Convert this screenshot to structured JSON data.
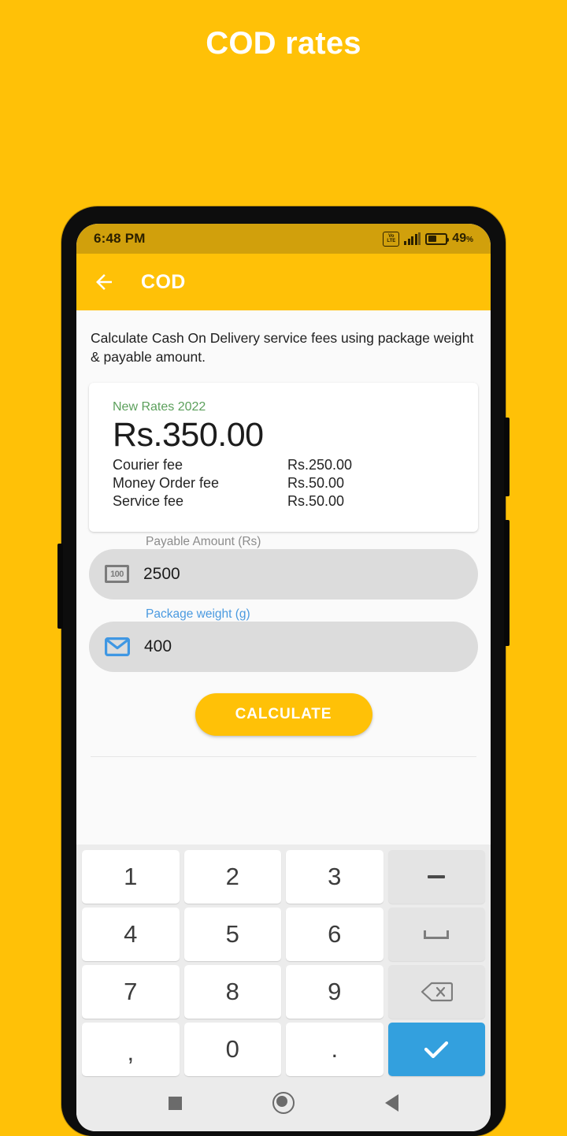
{
  "banner": {
    "title": "COD rates",
    "background_color": "#FFC107"
  },
  "status_bar": {
    "time": "6:48 PM",
    "network_badge": "VoLTE",
    "volte_top": "Vo",
    "volte_bottom": "LTE",
    "battery_percent": "49",
    "percent_sign": "%"
  },
  "app_bar": {
    "title": "COD",
    "back_icon": "back-arrow-icon",
    "background_color": "#FFC107"
  },
  "content": {
    "intro_text": "Calculate Cash On Delivery service fees using package weight & payable amount.",
    "rate_card": {
      "rates_label": "New Rates 2022",
      "rates_label_color": "#5CA05C",
      "total_amount": "Rs.350.00",
      "fees": [
        {
          "name": "Courier fee",
          "value": "Rs.250.00"
        },
        {
          "name": "Money Order fee",
          "value": "Rs.50.00"
        },
        {
          "name": "Service fee",
          "value": "Rs.50.00"
        }
      ]
    },
    "fields": [
      {
        "label": "Payable Amount (Rs)",
        "value": "2500",
        "icon": "banknote-icon",
        "icon_text": "100",
        "state": "unfocused",
        "label_color": "#8c8c8c"
      },
      {
        "label": "Package weight (g)",
        "value": "400",
        "icon": "envelope-icon",
        "state": "focused",
        "label_color": "#4a9ae0"
      }
    ],
    "calculate_button": "CALCULATE"
  },
  "keyboard": {
    "rows": [
      [
        {
          "label": "1",
          "name": "key-1",
          "type": "digit"
        },
        {
          "label": "2",
          "name": "key-2",
          "type": "digit"
        },
        {
          "label": "3",
          "name": "key-3",
          "type": "digit"
        },
        {
          "label": "",
          "name": "key-minus",
          "type": "minus"
        }
      ],
      [
        {
          "label": "4",
          "name": "key-4",
          "type": "digit"
        },
        {
          "label": "5",
          "name": "key-5",
          "type": "digit"
        },
        {
          "label": "6",
          "name": "key-6",
          "type": "digit"
        },
        {
          "label": "",
          "name": "key-space",
          "type": "space"
        }
      ],
      [
        {
          "label": "7",
          "name": "key-7",
          "type": "digit"
        },
        {
          "label": "8",
          "name": "key-8",
          "type": "digit"
        },
        {
          "label": "9",
          "name": "key-9",
          "type": "digit"
        },
        {
          "label": "",
          "name": "key-backspace",
          "type": "backspace"
        }
      ],
      [
        {
          "label": ",",
          "name": "key-comma",
          "type": "comma"
        },
        {
          "label": "0",
          "name": "key-0",
          "type": "digit"
        },
        {
          "label": ".",
          "name": "key-dot",
          "type": "dot"
        },
        {
          "label": "",
          "name": "key-enter",
          "type": "enter"
        }
      ]
    ],
    "enter_color": "#33A0DE"
  },
  "nav_bar": {
    "recents_icon": "square-recents-icon",
    "home_icon": "circle-home-icon",
    "back_icon": "triangle-back-icon"
  }
}
